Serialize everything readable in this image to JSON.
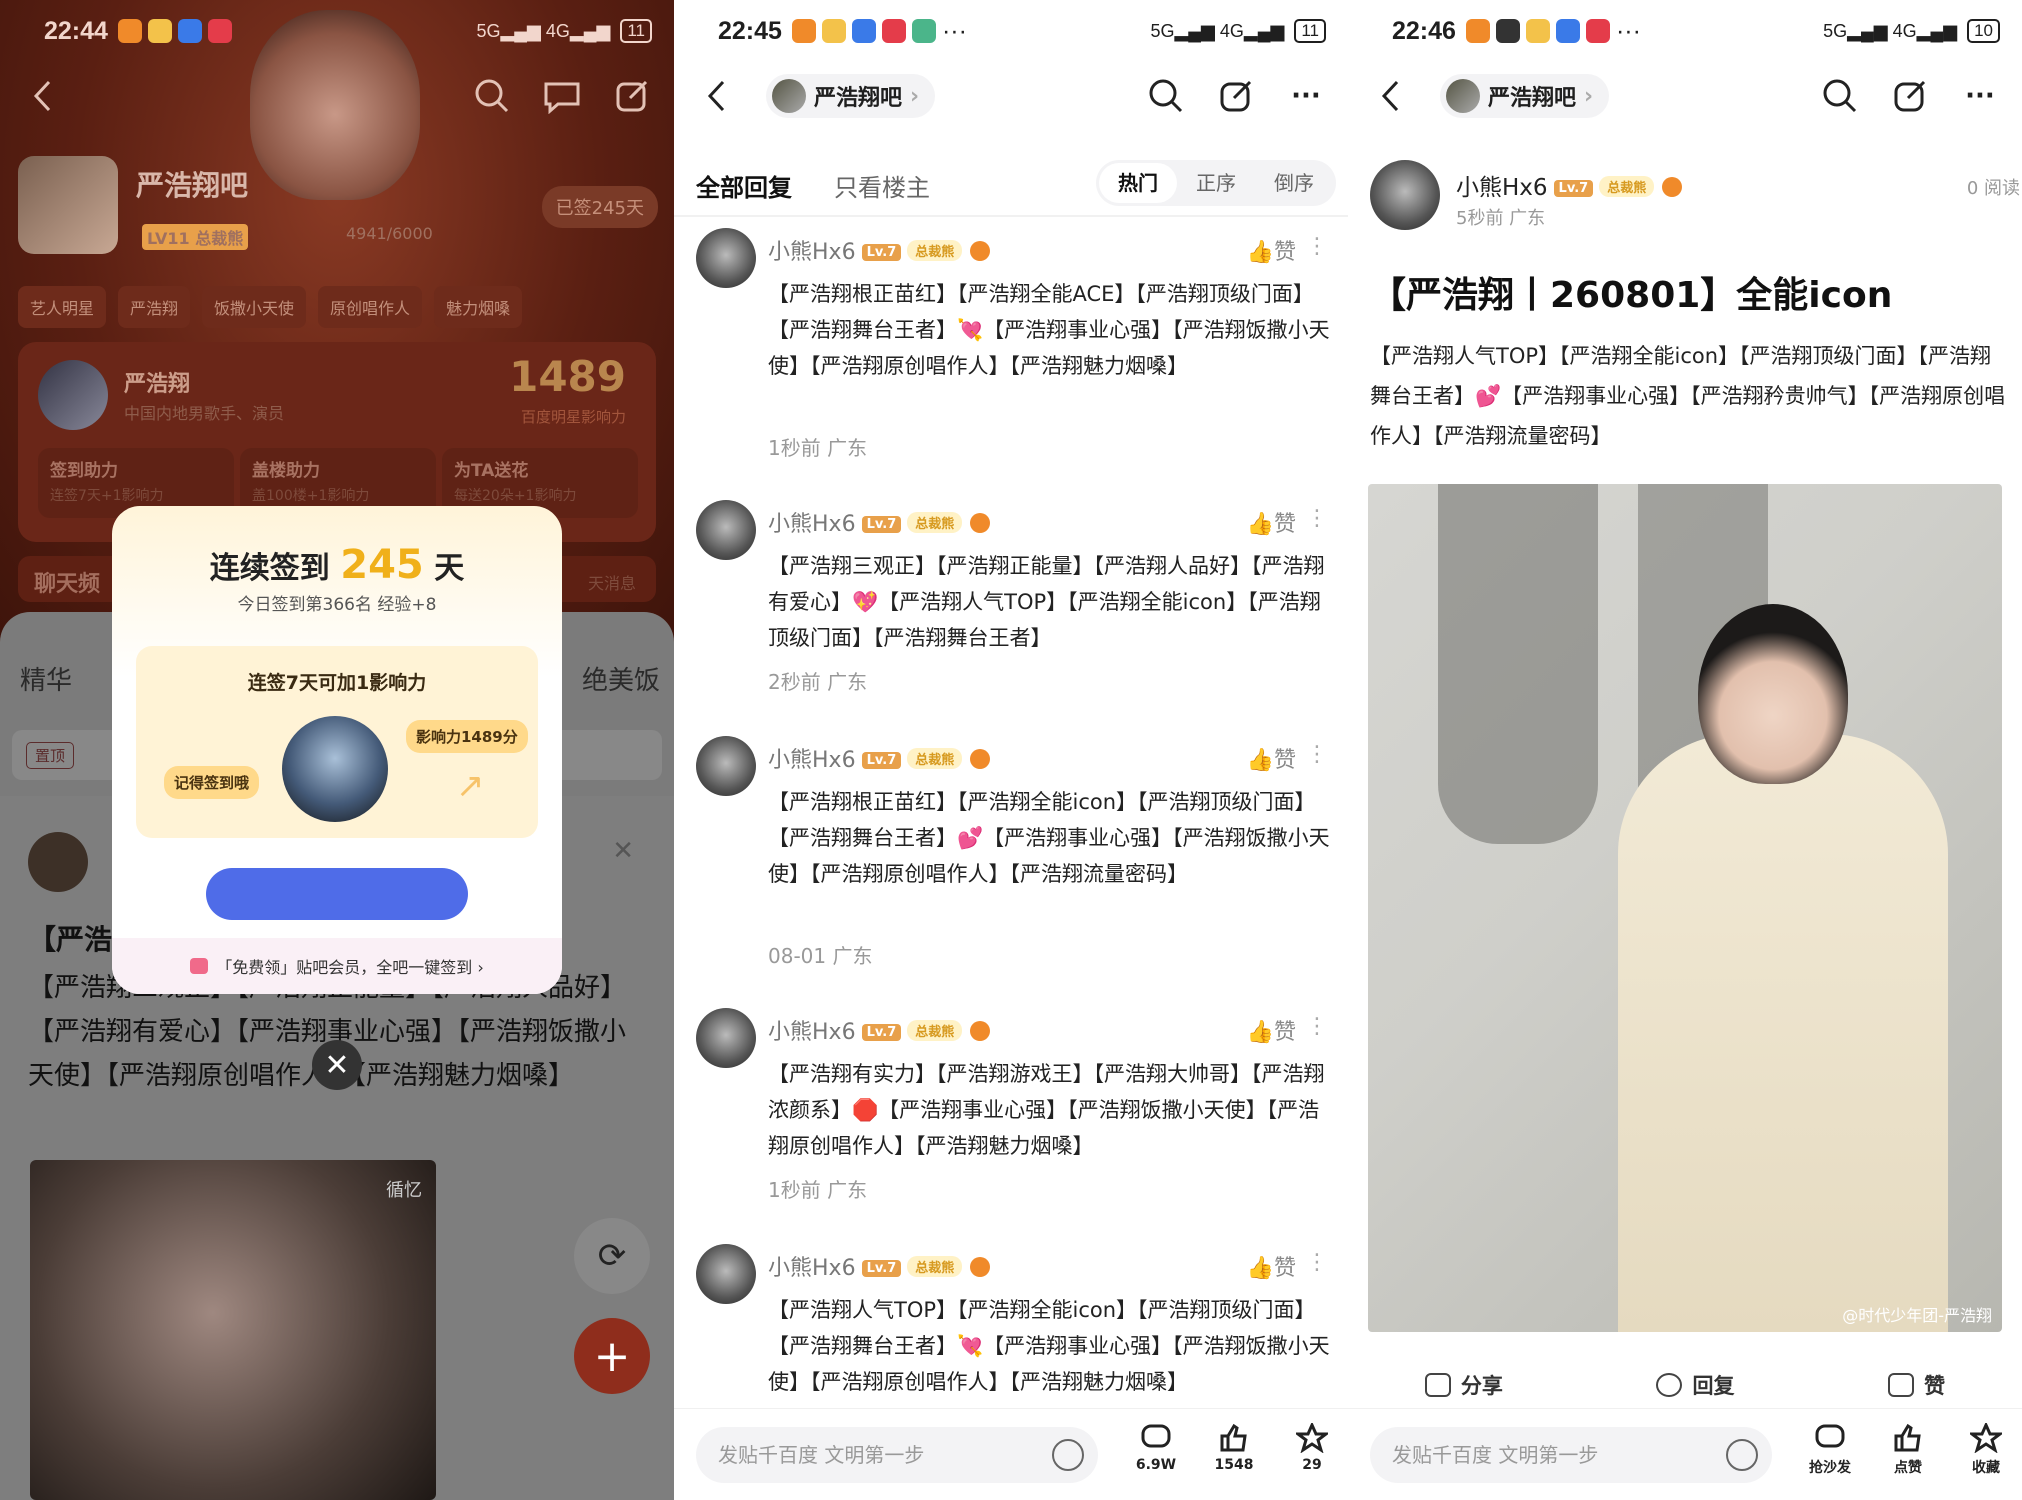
{
  "panel1": {
    "status": {
      "time": "22:44",
      "battery": "11"
    },
    "forum": {
      "name": "严浩翔吧",
      "level": "LV11 总裁熊",
      "exp": "4941/6000",
      "signed": "已签245天"
    },
    "tags": [
      "艺人明星",
      "严浩翔",
      "饭撒小天使",
      "原创唱作人",
      "魅力烟嗓"
    ],
    "star": {
      "name": "严浩翔",
      "desc": "中国内地男歌手、演员",
      "score": "1489",
      "board": "百度明星影响力",
      "helps": [
        {
          "title": "签到助力",
          "sub": "连签7天+1影响力"
        },
        {
          "title": "盖楼助力",
          "sub": "盖100楼+1影响力"
        },
        {
          "title": "为TA送花",
          "sub": "每送20朵+1影响力"
        }
      ]
    },
    "chat": {
      "label": "聊天频",
      "tail": "天消息"
    },
    "feed_tabs": [
      "精华",
      "绝美饭"
    ],
    "pin": "置顶",
    "post": {
      "title": "【严浩",
      "text": "【严浩翔三观正】【严浩翔正能量】【严浩翔人品好】【严浩翔有爱心】【严浩翔事业心强】【严浩翔饭撒小天使】【严浩翔原创唱作人】【严浩翔魅力烟嗓】"
    },
    "img_wm": "循忆",
    "modal": {
      "title_pre": "连续签到",
      "days": "245",
      "title_post": "天",
      "subtitle": "今日签到第366名 经验+8",
      "box_title": "连签7天可加1影响力",
      "left_tag": "记得签到哦",
      "right_tag": "影响力1489分",
      "footer": "「免费领」贴吧会员，全吧一键签到 ›"
    }
  },
  "panel2": {
    "status": {
      "time": "22:45",
      "battery": "11"
    },
    "bar_name": "严浩翔吧",
    "tab_all": "全部回复",
    "tab_op": "只看楼主",
    "sort": [
      "热门",
      "正序",
      "倒序"
    ],
    "replies": [
      {
        "user": "小熊Hx6",
        "lv": "Lv.7",
        "badge": "总裁熊",
        "like": "赞",
        "text": "【严浩翔根正苗红】【严浩翔全能ACE】【严浩翔顶级门面】【严浩翔舞台王者】💘【严浩翔事业心强】【严浩翔饭撒小天使】【严浩翔原创唱作人】【严浩翔魅力烟嗓】",
        "time": "1秒前 广东"
      },
      {
        "user": "小熊Hx6",
        "lv": "Lv.7",
        "badge": "总裁熊",
        "like": "赞",
        "text": "【严浩翔三观正】【严浩翔正能量】【严浩翔人品好】【严浩翔有爱心】💖【严浩翔人气TOP】【严浩翔全能icon】【严浩翔顶级门面】【严浩翔舞台王者】",
        "time": "2秒前 广东"
      },
      {
        "user": "小熊Hx6",
        "lv": "Lv.7",
        "badge": "总裁熊",
        "like": "赞",
        "text": "【严浩翔根正苗红】【严浩翔全能icon】【严浩翔顶级门面】【严浩翔舞台王者】💕【严浩翔事业心强】【严浩翔饭撒小天使】【严浩翔原创唱作人】【严浩翔流量密码】",
        "time": "08-01 广东"
      },
      {
        "user": "小熊Hx6",
        "lv": "Lv.7",
        "badge": "总裁熊",
        "like": "赞",
        "text": "【严浩翔有实力】【严浩翔游戏王】【严浩翔大帅哥】【严浩翔浓颜系】🛑【严浩翔事业心强】【严浩翔饭撒小天使】【严浩翔原创唱作人】【严浩翔魅力烟嗓】",
        "time": "1秒前 广东"
      },
      {
        "user": "小熊Hx6",
        "lv": "Lv.7",
        "badge": "总裁熊",
        "like": "赞",
        "text": "【严浩翔人气TOP】【严浩翔全能icon】【严浩翔顶级门面】【严浩翔舞台王者】💘【严浩翔事业心强】【严浩翔饭撒小天使】【严浩翔原创唱作人】【严浩翔魅力烟嗓】",
        "time": ""
      }
    ],
    "input_placeholder": "发贴千百度 文明第一步",
    "bottom": [
      {
        "label": "6.9W"
      },
      {
        "label": "1548"
      },
      {
        "label": "29"
      }
    ]
  },
  "panel3": {
    "status": {
      "time": "22:46",
      "battery": "10"
    },
    "bar_name": "严浩翔吧",
    "author": {
      "name": "小熊Hx6",
      "lv": "Lv.7",
      "badge": "总裁熊",
      "meta": "5秒前  广东",
      "reads": "0 阅读"
    },
    "title": "【严浩翔丨260801】全能icon",
    "body": "【严浩翔人气TOP】【严浩翔全能icon】【严浩翔顶级门面】【严浩翔舞台王者】💕【严浩翔事业心强】【严浩翔矜贵帅气】【严浩翔原创唱作人】【严浩翔流量密码】",
    "photo_wm": "@时代少年团-严浩翔",
    "actions": [
      "分享",
      "回复",
      "赞"
    ],
    "input_placeholder": "发贴千百度 文明第一步",
    "bottom": [
      {
        "label": "抢沙发"
      },
      {
        "label": "点赞"
      },
      {
        "label": "收藏"
      }
    ]
  }
}
